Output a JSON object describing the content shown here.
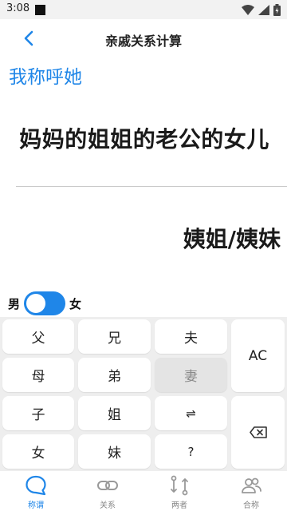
{
  "status_bar": {
    "time": "3:08"
  },
  "nav": {
    "title": "亲戚关系计算"
  },
  "call_label": "我称呼她",
  "relation": "妈妈的姐姐的老公的女儿",
  "result": "姨姐/姨妹",
  "gender": {
    "male": "男",
    "female": "女",
    "selected": "female"
  },
  "keys": {
    "father": "父",
    "older_brother": "兄",
    "husband": "夫",
    "clear": "AC",
    "mother": "母",
    "younger_brother": "弟",
    "wife": "妻",
    "son": "子",
    "older_sister": "姐",
    "swap": "⇌",
    "backspace": "backspace-icon",
    "daughter": "女",
    "younger_sister": "妹",
    "question": "?"
  },
  "tabs": [
    {
      "label": "称谓",
      "icon": "chat-bubble-icon",
      "active": true
    },
    {
      "label": "关系",
      "icon": "link-icon",
      "active": false
    },
    {
      "label": "两者",
      "icon": "compare-arrows-icon",
      "active": false
    },
    {
      "label": "合称",
      "icon": "people-icon",
      "active": false
    }
  ],
  "colors": {
    "accent": "#1f86e8",
    "keypad_bg": "#eeeeee",
    "key_bg": "#ffffff",
    "key_disabled_bg": "#e4e4e4"
  }
}
